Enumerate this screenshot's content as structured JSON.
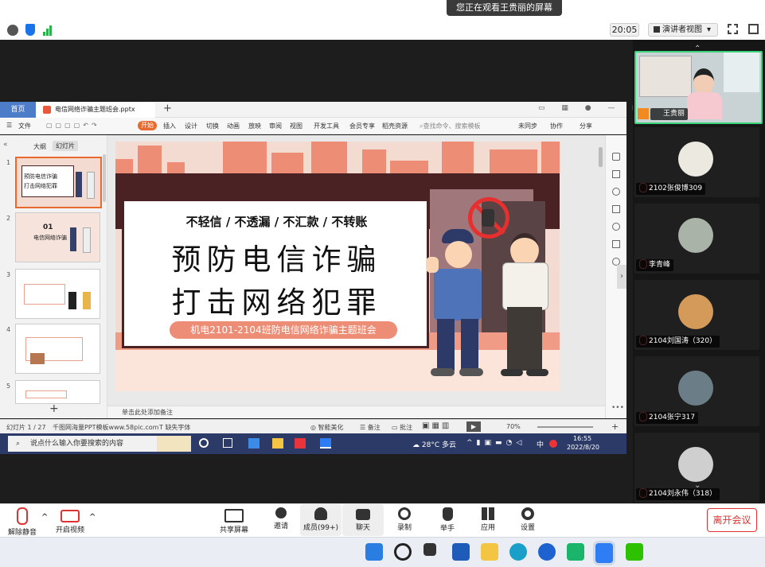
{
  "zoom_top": {
    "share_banner": "您正在观看王贵丽的屏幕",
    "time": "20:05",
    "view_label": "演讲者视图"
  },
  "wps": {
    "home_tab": "首页",
    "file_tab": "电信网络诈骗主题班会.pptx",
    "menu": [
      "文件",
      "开始",
      "插入",
      "设计",
      "切换",
      "动画",
      "放映",
      "审阅",
      "视图",
      "开发工具",
      "会员专享",
      "稻壳资源"
    ],
    "search_placeholder": "查找命令、搜索模板",
    "right_menu": [
      "未同步",
      "协作",
      "分享"
    ],
    "panel_tabs": [
      "大纲",
      "幻灯片"
    ],
    "notes_placeholder": "单击此处添加备注",
    "status": {
      "slide_count": "幻灯片 1 / 27",
      "theme": "千图网海量PPT模板www.58pic.com",
      "missing_font": "缺失字体",
      "smart_beautify": "智能美化",
      "notes": "备注",
      "comments": "批注",
      "zoom": "70%"
    },
    "thumbs": [
      {
        "num": "1",
        "line1": "预防电信诈骗",
        "line2": "打击网络犯罪"
      },
      {
        "num": "2",
        "title_num": "01",
        "title": "电信网络诈骗"
      },
      {
        "num": "3"
      },
      {
        "num": "4"
      },
      {
        "num": "5"
      }
    ]
  },
  "slide": {
    "slogan": "不轻信 / 不透漏 / 不汇款 / 不转账",
    "line1": "预防电信诈骗",
    "line2": "打击网络犯罪",
    "subtitle": "机电2101-2104班防电信网络诈骗主题班会"
  },
  "inner_taskbar": {
    "search_text": "说点什么输入你要搜索的内容",
    "weather": "28°C 多云",
    "ime": "中",
    "clock_time": "16:55",
    "clock_date": "2022/8/20"
  },
  "participants": [
    {
      "name": "王贵丽",
      "muted": false
    },
    {
      "name": "2102张俊博309",
      "muted": true
    },
    {
      "name": "李青峰",
      "muted": true
    },
    {
      "name": "2104刘国涛（320）",
      "muted": true
    },
    {
      "name": "2104张宁317",
      "muted": true
    },
    {
      "name": "2104刘永伟（318）",
      "muted": true
    }
  ],
  "toolbar": {
    "unmute": "解除静音",
    "video": "开启视频",
    "share": "共享屏幕",
    "invite": "邀请",
    "members": "成员(99+)",
    "chat": "聊天",
    "record": "录制",
    "raise_hand": "举手",
    "apps": "应用",
    "settings": "设置",
    "leave": "离开会议"
  },
  "colors": {
    "wps_orange": "#e86a2e",
    "slide_bg": "#f4dbd2",
    "building": "#ee8d76",
    "dark_maroon": "#4a2224",
    "leave_red": "#d33333"
  }
}
